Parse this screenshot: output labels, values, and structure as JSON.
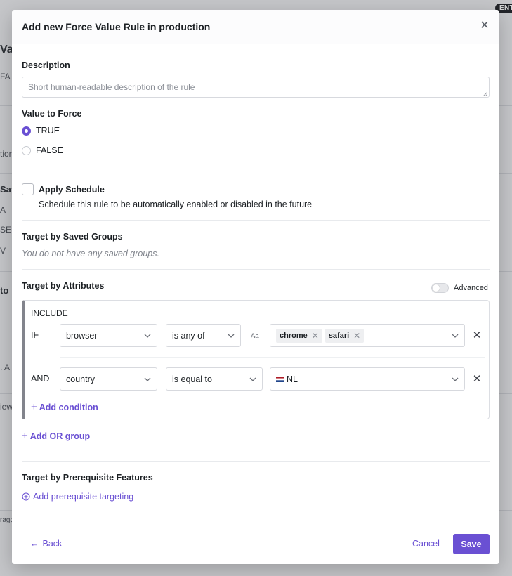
{
  "background": {
    "badge": "ENT",
    "fragments": [
      "Va",
      "FA",
      "tion",
      "Saf",
      "A",
      "SER",
      "V",
      "to",
      ". A",
      "iew",
      "ragg"
    ]
  },
  "modal": {
    "title": "Add new Force Value Rule in production",
    "close_icon": "close-icon",
    "description": {
      "label": "Description",
      "placeholder": "Short human-readable description of the rule"
    },
    "value_to_force": {
      "label": "Value to Force",
      "options": [
        {
          "label": "TRUE",
          "selected": true
        },
        {
          "label": "FALSE",
          "selected": false
        }
      ]
    },
    "schedule": {
      "label": "Apply Schedule",
      "help": "Schedule this rule to be automatically enabled or disabled in the future",
      "checked": false
    },
    "saved_groups": {
      "label": "Target by Saved Groups",
      "empty": "You do not have any saved groups."
    },
    "attributes": {
      "label": "Target by Attributes",
      "advanced_label": "Advanced",
      "advanced_on": false,
      "include_label": "INCLUDE",
      "conditions": [
        {
          "prefix": "IF",
          "attribute": "browser",
          "operator": "is any of",
          "case_icon": "Aa",
          "values": [
            "chrome",
            "safari"
          ]
        },
        {
          "prefix": "AND",
          "attribute": "country",
          "operator": "is equal to",
          "flag": "🇳🇱",
          "value_text": "NL"
        }
      ],
      "add_condition": "Add condition",
      "add_or_group": "Add OR group"
    },
    "prerequisites": {
      "label": "Target by Prerequisite Features",
      "add_link": "Add prerequisite targeting"
    },
    "footer": {
      "back": "Back",
      "cancel": "Cancel",
      "save": "Save"
    }
  },
  "colors": {
    "accent": "#6a50d3",
    "text": "#1c2024",
    "muted": "#80848c"
  }
}
